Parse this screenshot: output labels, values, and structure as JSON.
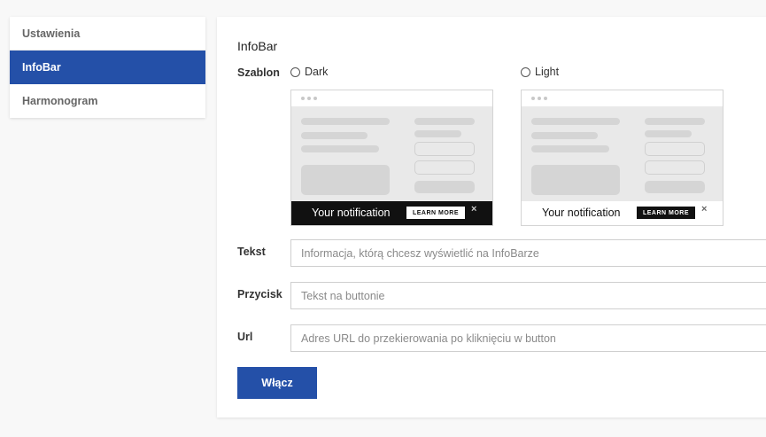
{
  "sidebar": {
    "items": [
      {
        "label": "Ustawienia"
      },
      {
        "label": "InfoBar"
      },
      {
        "label": "Harmonogram"
      }
    ]
  },
  "panel": {
    "title": "InfoBar",
    "template_label": "Szablon",
    "options": [
      {
        "label": "Dark",
        "notification_text": "Your notification",
        "button_text": "LEARN MORE",
        "close_glyph": "×"
      },
      {
        "label": "Light",
        "notification_text": "Your notification",
        "button_text": "LEARN MORE",
        "close_glyph": "×"
      }
    ],
    "text_label": "Tekst",
    "text_placeholder": "Informacja, którą chcesz wyświetlić na InfoBarze",
    "button_label": "Przycisk",
    "button_placeholder": "Tekst na buttonie",
    "url_label": "Url",
    "url_placeholder": "Adres URL do przekierowania po kliknięciu w button",
    "submit_label": "Włącz"
  },
  "colors": {
    "accent": "#2450a8",
    "background": "#f8f8f8"
  }
}
